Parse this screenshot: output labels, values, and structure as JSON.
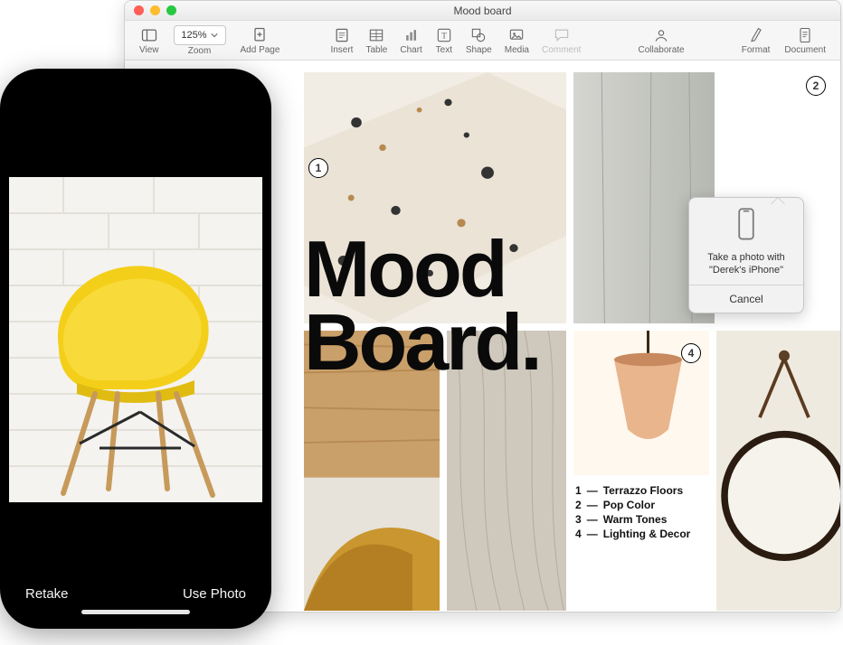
{
  "window": {
    "title": "Mood board",
    "zoom": "125%",
    "toolbar": {
      "view": "View",
      "zoom": "Zoom",
      "addPage": "Add Page",
      "insert": "Insert",
      "table": "Table",
      "chart": "Chart",
      "text": "Text",
      "shape": "Shape",
      "media": "Media",
      "comment": "Comment",
      "collaborate": "Collaborate",
      "format": "Format",
      "document": "Document"
    }
  },
  "document": {
    "headline_l1": "Mood",
    "headline_l2": "Board.",
    "badges": {
      "b1": "1",
      "b2": "2",
      "b4": "4"
    },
    "legend": [
      {
        "n": "1",
        "label": "Terrazzo Floors"
      },
      {
        "n": "2",
        "label": "Pop Color"
      },
      {
        "n": "3",
        "label": "Warm Tones"
      },
      {
        "n": "4",
        "label": "Lighting & Decor"
      }
    ]
  },
  "popover": {
    "line1": "Take a photo with",
    "line2": "\"Derek's iPhone\"",
    "cancel": "Cancel"
  },
  "phone": {
    "retake": "Retake",
    "usePhoto": "Use Photo"
  }
}
